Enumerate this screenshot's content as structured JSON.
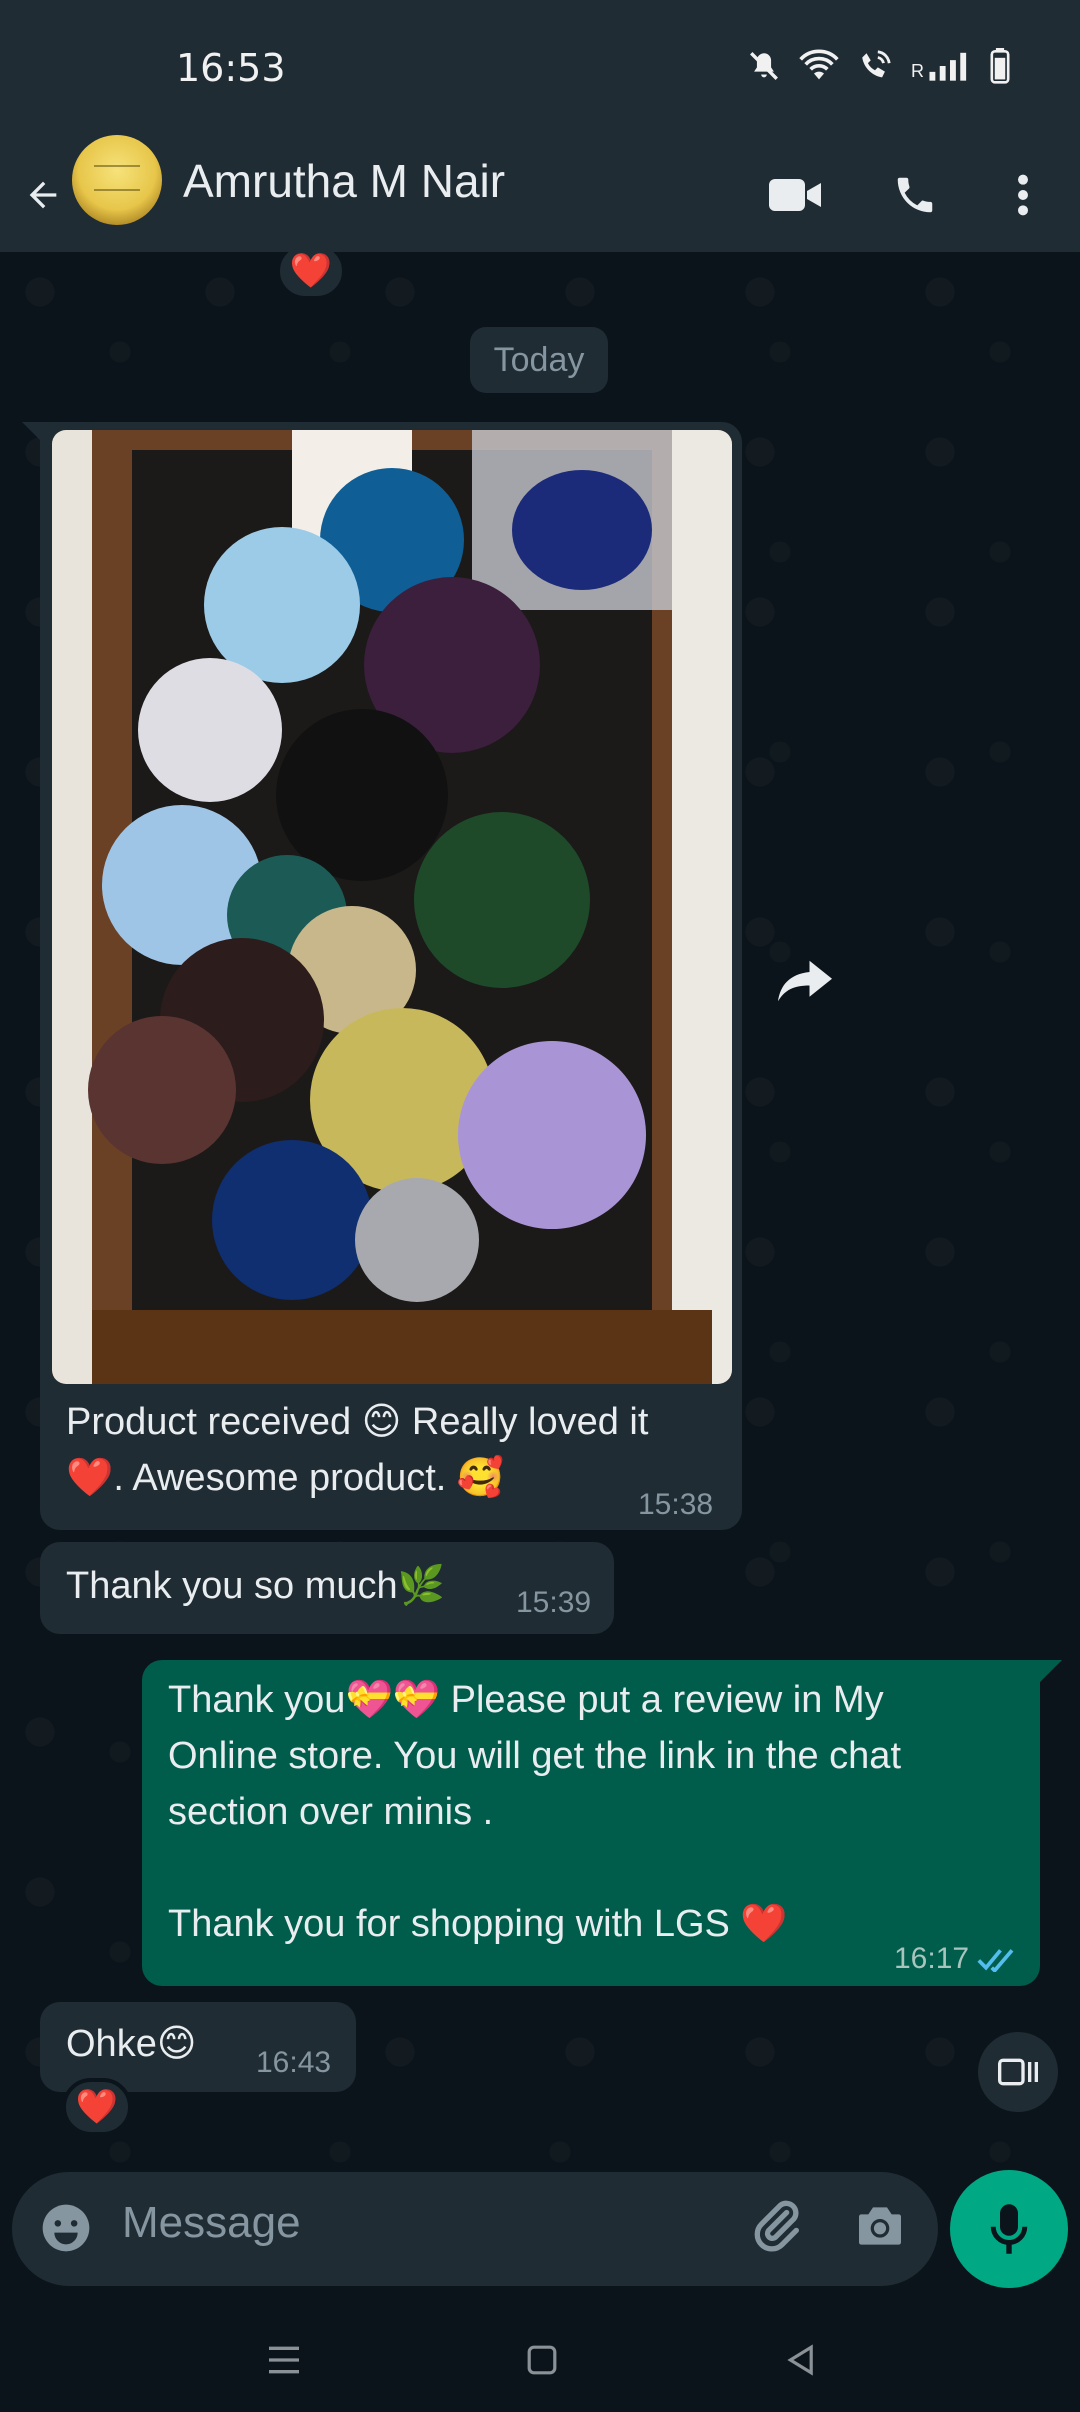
{
  "status_bar": {
    "time": "16:53",
    "network_label": "R"
  },
  "header": {
    "contact_name": "Amrutha M Nair",
    "icons": [
      "back-arrow-icon",
      "video-call-icon",
      "voice-call-icon",
      "more-options-icon"
    ]
  },
  "chat": {
    "top_reaction": "❤️",
    "date_divider": "Today",
    "messages": [
      {
        "direction": "incoming",
        "type": "image",
        "image_description_icon": "photo",
        "caption_line1": "Product received 😊 Really loved it",
        "caption_line2": "❤️. Awesome product. 🥰",
        "time": "15:38"
      },
      {
        "direction": "incoming",
        "type": "text",
        "text": "Thank you so much🌿",
        "time": "15:39"
      },
      {
        "direction": "outgoing",
        "type": "text",
        "line1": "Thank you💝💝 Please put a review in My",
        "line2": "Online store. You will get the link in the chat",
        "line3": "section over minis .",
        "line4": "Thank you for shopping with LGS ❤️",
        "time": "16:17",
        "status": "read"
      },
      {
        "direction": "incoming",
        "type": "text",
        "text": "Ohke😊",
        "time": "16:43",
        "reaction": "❤️"
      }
    ]
  },
  "composer": {
    "placeholder": "Message"
  },
  "colors": {
    "background": "#0b141a",
    "bar": "#1f2c34",
    "incoming_bubble": "#1f2c34",
    "outgoing_bubble": "#005c4b",
    "accent": "#00a884",
    "read_ticks": "#53bdeb"
  }
}
